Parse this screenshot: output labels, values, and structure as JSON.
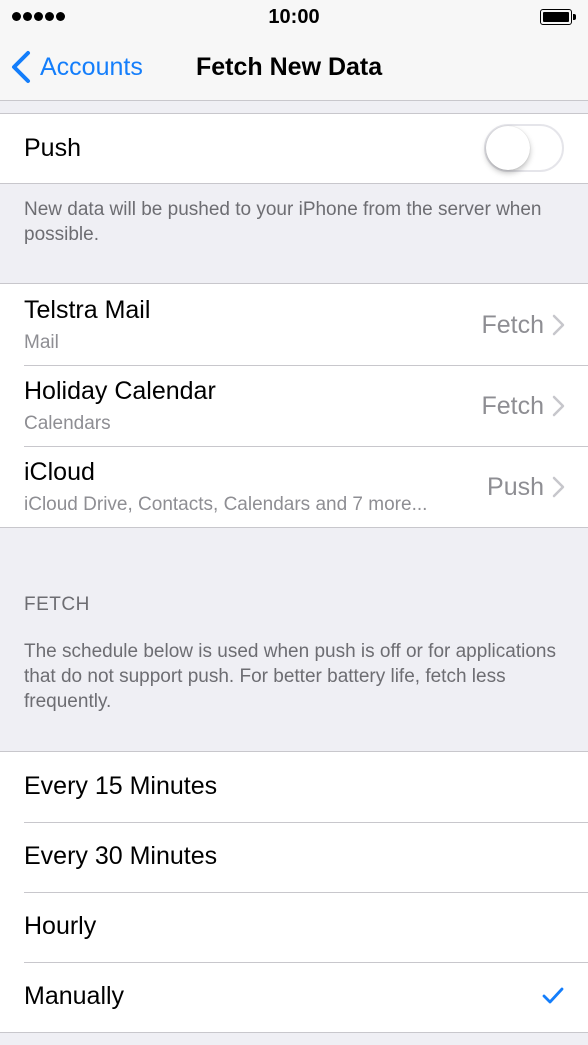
{
  "status_bar": {
    "time": "10:00"
  },
  "nav": {
    "back_label": "Accounts",
    "title": "Fetch New Data"
  },
  "push_section": {
    "label": "Push",
    "enabled": false,
    "note": "New data will be pushed to your iPhone from the server when possible."
  },
  "accounts": [
    {
      "title": "Telstra Mail",
      "subtitle": "Mail",
      "value": "Fetch"
    },
    {
      "title": "Holiday Calendar",
      "subtitle": "Calendars",
      "value": "Fetch"
    },
    {
      "title": "iCloud",
      "subtitle": "iCloud Drive, Contacts, Calendars and 7 more...",
      "value": "Push"
    }
  ],
  "fetch_section": {
    "header": "FETCH",
    "note": "The schedule below is used when push is off or for applications that do not support push. For better battery life, fetch less frequently.",
    "options": [
      {
        "label": "Every 15 Minutes",
        "selected": false
      },
      {
        "label": "Every 30 Minutes",
        "selected": false
      },
      {
        "label": "Hourly",
        "selected": false
      },
      {
        "label": "Manually",
        "selected": true
      }
    ]
  },
  "colors": {
    "tint": "#147efb",
    "background": "#efeff4",
    "secondary_text": "#8e8e93"
  }
}
